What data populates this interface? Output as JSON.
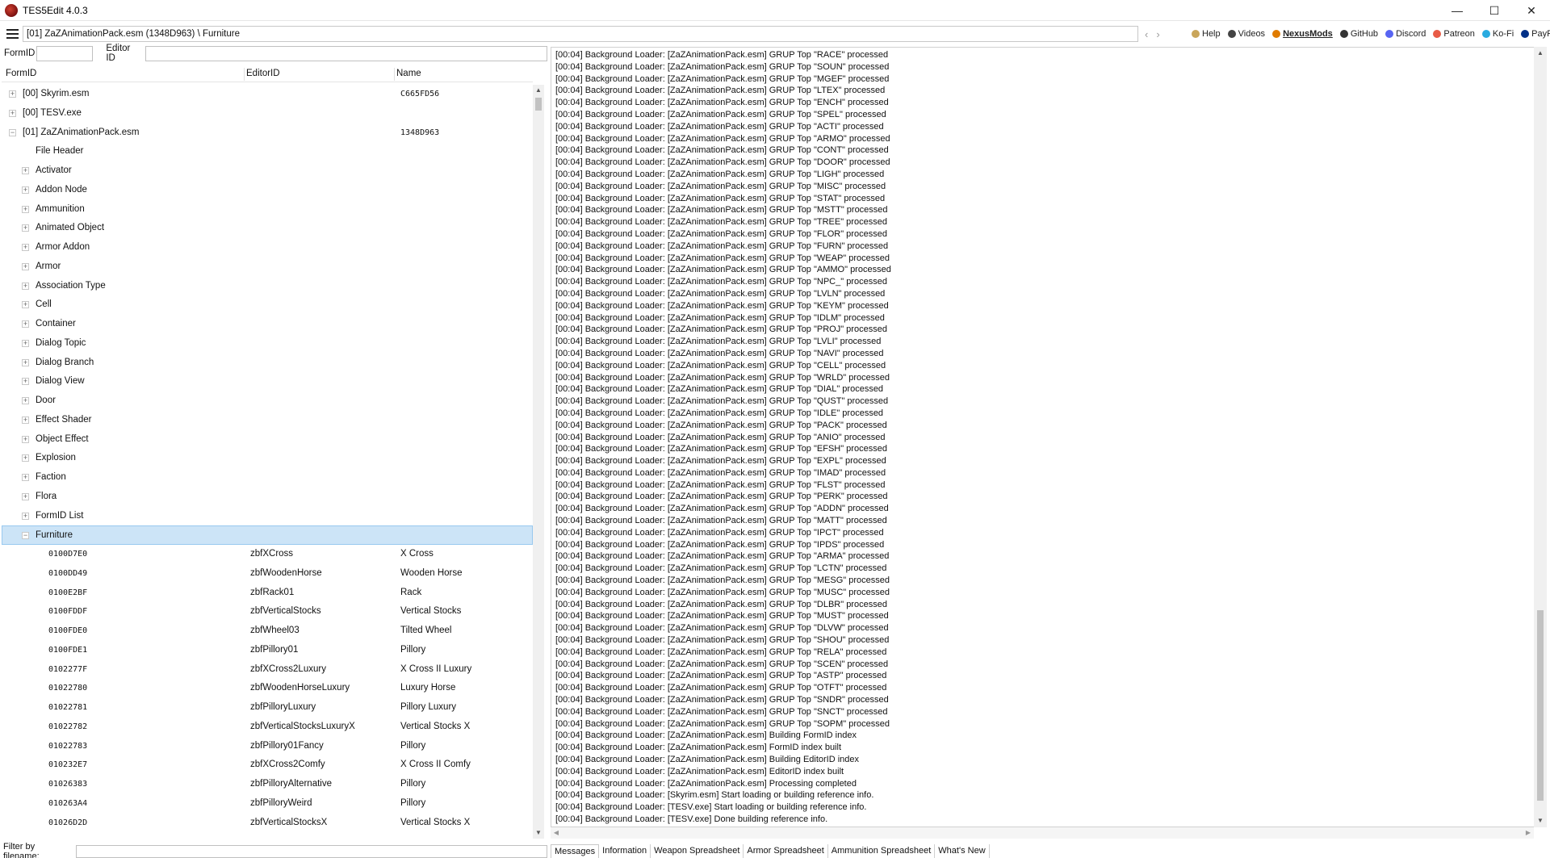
{
  "window": {
    "title": "TES5Edit 4.0.3",
    "minimize": "—",
    "maximize": "☐",
    "close": "✕"
  },
  "nav": {
    "path": "[01] ZaZAnimationPack.esm (1348D963) \\ Furniture",
    "back": "‹",
    "forward": "›",
    "links": [
      {
        "label": "Help",
        "icon": "book-icon",
        "color": "#c9a55a"
      },
      {
        "label": "Videos",
        "icon": "video-icon",
        "color": "#444444"
      },
      {
        "label": "NexusMods",
        "icon": "nexus-icon",
        "color": "#e07b00"
      },
      {
        "label": "GitHub",
        "icon": "github-icon",
        "color": "#333333"
      },
      {
        "label": "Discord",
        "icon": "discord-icon",
        "color": "#5865f2"
      },
      {
        "label": "Patreon",
        "icon": "patreon-icon",
        "color": "#e85b46"
      },
      {
        "label": "Ko-Fi",
        "icon": "kofi-icon",
        "color": "#29abe0"
      },
      {
        "label": "PayPal",
        "icon": "paypal-icon",
        "color": "#003087"
      }
    ]
  },
  "filters": {
    "formid_label": "FormID",
    "editorid_label": "Editor ID",
    "filename_label": "Filter by filename:"
  },
  "tree_columns": [
    "FormID",
    "EditorID",
    "Name"
  ],
  "tree_files": [
    {
      "label": "[00] Skyrim.esm",
      "name": "C665FD56",
      "exp": "+"
    },
    {
      "label": "[00] TESV.exe",
      "name": "",
      "exp": "+"
    },
    {
      "label": "[01] ZaZAnimationPack.esm",
      "name": "1348D963",
      "exp": "−"
    }
  ],
  "tree_file_header": "File Header",
  "tree_groups": [
    "Activator",
    "Addon Node",
    "Ammunition",
    "Animated Object",
    "Armor Addon",
    "Armor",
    "Association Type",
    "Cell",
    "Container",
    "Dialog Topic",
    "Dialog Branch",
    "Dialog View",
    "Door",
    "Effect Shader",
    "Object Effect",
    "Explosion",
    "Faction",
    "Flora",
    "FormID List"
  ],
  "tree_selected": "Furniture",
  "records": [
    {
      "formid": "0100D7E0",
      "editorid": "zbfXCross",
      "name": "X Cross"
    },
    {
      "formid": "0100DD49",
      "editorid": "zbfWoodenHorse",
      "name": "Wooden Horse"
    },
    {
      "formid": "0100E2BF",
      "editorid": "zbfRack01",
      "name": "Rack"
    },
    {
      "formid": "0100FDDF",
      "editorid": "zbfVerticalStocks",
      "name": "Vertical Stocks"
    },
    {
      "formid": "0100FDE0",
      "editorid": "zbfWheel03",
      "name": "Tilted Wheel"
    },
    {
      "formid": "0100FDE1",
      "editorid": "zbfPillory01",
      "name": "Pillory"
    },
    {
      "formid": "0102277F",
      "editorid": "zbfXCross2Luxury",
      "name": "X Cross II Luxury"
    },
    {
      "formid": "01022780",
      "editorid": "zbfWoodenHorseLuxury",
      "name": "Luxury Horse"
    },
    {
      "formid": "01022781",
      "editorid": "zbfPilloryLuxury",
      "name": "Pillory Luxury"
    },
    {
      "formid": "01022782",
      "editorid": "zbfVerticalStocksLuxuryX",
      "name": "Vertical Stocks X"
    },
    {
      "formid": "01022783",
      "editorid": "zbfPillory01Fancy",
      "name": "Pillory"
    },
    {
      "formid": "010232E7",
      "editorid": "zbfXCross2Comfy",
      "name": "X Cross II Comfy"
    },
    {
      "formid": "01026383",
      "editorid": "zbfPilloryAlternative",
      "name": "Pillory"
    },
    {
      "formid": "010263A4",
      "editorid": "zbfPilloryWeird",
      "name": "Pillory"
    },
    {
      "formid": "01026D2D",
      "editorid": "zbfVerticalStocksX",
      "name": "Vertical Stocks X"
    }
  ],
  "messages": [
    "[00:04] Background Loader: [ZaZAnimationPack.esm] GRUP Top \"RACE\" processed",
    "[00:04] Background Loader: [ZaZAnimationPack.esm] GRUP Top \"SOUN\" processed",
    "[00:04] Background Loader: [ZaZAnimationPack.esm] GRUP Top \"MGEF\" processed",
    "[00:04] Background Loader: [ZaZAnimationPack.esm] GRUP Top \"LTEX\" processed",
    "[00:04] Background Loader: [ZaZAnimationPack.esm] GRUP Top \"ENCH\" processed",
    "[00:04] Background Loader: [ZaZAnimationPack.esm] GRUP Top \"SPEL\" processed",
    "[00:04] Background Loader: [ZaZAnimationPack.esm] GRUP Top \"ACTI\" processed",
    "[00:04] Background Loader: [ZaZAnimationPack.esm] GRUP Top \"ARMO\" processed",
    "[00:04] Background Loader: [ZaZAnimationPack.esm] GRUP Top \"CONT\" processed",
    "[00:04] Background Loader: [ZaZAnimationPack.esm] GRUP Top \"DOOR\" processed",
    "[00:04] Background Loader: [ZaZAnimationPack.esm] GRUP Top \"LIGH\" processed",
    "[00:04] Background Loader: [ZaZAnimationPack.esm] GRUP Top \"MISC\" processed",
    "[00:04] Background Loader: [ZaZAnimationPack.esm] GRUP Top \"STAT\" processed",
    "[00:04] Background Loader: [ZaZAnimationPack.esm] GRUP Top \"MSTT\" processed",
    "[00:04] Background Loader: [ZaZAnimationPack.esm] GRUP Top \"TREE\" processed",
    "[00:04] Background Loader: [ZaZAnimationPack.esm] GRUP Top \"FLOR\" processed",
    "[00:04] Background Loader: [ZaZAnimationPack.esm] GRUP Top \"FURN\" processed",
    "[00:04] Background Loader: [ZaZAnimationPack.esm] GRUP Top \"WEAP\" processed",
    "[00:04] Background Loader: [ZaZAnimationPack.esm] GRUP Top \"AMMO\" processed",
    "[00:04] Background Loader: [ZaZAnimationPack.esm] GRUP Top \"NPC_\" processed",
    "[00:04] Background Loader: [ZaZAnimationPack.esm] GRUP Top \"LVLN\" processed",
    "[00:04] Background Loader: [ZaZAnimationPack.esm] GRUP Top \"KEYM\" processed",
    "[00:04] Background Loader: [ZaZAnimationPack.esm] GRUP Top \"IDLM\" processed",
    "[00:04] Background Loader: [ZaZAnimationPack.esm] GRUP Top \"PROJ\" processed",
    "[00:04] Background Loader: [ZaZAnimationPack.esm] GRUP Top \"LVLI\" processed",
    "[00:04] Background Loader: [ZaZAnimationPack.esm] GRUP Top \"NAVI\" processed",
    "[00:04] Background Loader: [ZaZAnimationPack.esm] GRUP Top \"CELL\" processed",
    "[00:04] Background Loader: [ZaZAnimationPack.esm] GRUP Top \"WRLD\" processed",
    "[00:04] Background Loader: [ZaZAnimationPack.esm] GRUP Top \"DIAL\" processed",
    "[00:04] Background Loader: [ZaZAnimationPack.esm] GRUP Top \"QUST\" processed",
    "[00:04] Background Loader: [ZaZAnimationPack.esm] GRUP Top \"IDLE\" processed",
    "[00:04] Background Loader: [ZaZAnimationPack.esm] GRUP Top \"PACK\" processed",
    "[00:04] Background Loader: [ZaZAnimationPack.esm] GRUP Top \"ANIO\" processed",
    "[00:04] Background Loader: [ZaZAnimationPack.esm] GRUP Top \"EFSH\" processed",
    "[00:04] Background Loader: [ZaZAnimationPack.esm] GRUP Top \"EXPL\" processed",
    "[00:04] Background Loader: [ZaZAnimationPack.esm] GRUP Top \"IMAD\" processed",
    "[00:04] Background Loader: [ZaZAnimationPack.esm] GRUP Top \"FLST\" processed",
    "[00:04] Background Loader: [ZaZAnimationPack.esm] GRUP Top \"PERK\" processed",
    "[00:04] Background Loader: [ZaZAnimationPack.esm] GRUP Top \"ADDN\" processed",
    "[00:04] Background Loader: [ZaZAnimationPack.esm] GRUP Top \"MATT\" processed",
    "[00:04] Background Loader: [ZaZAnimationPack.esm] GRUP Top \"IPCT\" processed",
    "[00:04] Background Loader: [ZaZAnimationPack.esm] GRUP Top \"IPDS\" processed",
    "[00:04] Background Loader: [ZaZAnimationPack.esm] GRUP Top \"ARMA\" processed",
    "[00:04] Background Loader: [ZaZAnimationPack.esm] GRUP Top \"LCTN\" processed",
    "[00:04] Background Loader: [ZaZAnimationPack.esm] GRUP Top \"MESG\" processed",
    "[00:04] Background Loader: [ZaZAnimationPack.esm] GRUP Top \"MUSC\" processed",
    "[00:04] Background Loader: [ZaZAnimationPack.esm] GRUP Top \"DLBR\" processed",
    "[00:04] Background Loader: [ZaZAnimationPack.esm] GRUP Top \"MUST\" processed",
    "[00:04] Background Loader: [ZaZAnimationPack.esm] GRUP Top \"DLVW\" processed",
    "[00:04] Background Loader: [ZaZAnimationPack.esm] GRUP Top \"SHOU\" processed",
    "[00:04] Background Loader: [ZaZAnimationPack.esm] GRUP Top \"RELA\" processed",
    "[00:04] Background Loader: [ZaZAnimationPack.esm] GRUP Top \"SCEN\" processed",
    "[00:04] Background Loader: [ZaZAnimationPack.esm] GRUP Top \"ASTP\" processed",
    "[00:04] Background Loader: [ZaZAnimationPack.esm] GRUP Top \"OTFT\" processed",
    "[00:04] Background Loader: [ZaZAnimationPack.esm] GRUP Top \"SNDR\" processed",
    "[00:04] Background Loader: [ZaZAnimationPack.esm] GRUP Top \"SNCT\" processed",
    "[00:04] Background Loader: [ZaZAnimationPack.esm] GRUP Top \"SOPM\" processed",
    "[00:04] Background Loader: [ZaZAnimationPack.esm] Building FormID index",
    "[00:04] Background Loader: [ZaZAnimationPack.esm] FormID index built",
    "[00:04] Background Loader: [ZaZAnimationPack.esm] Building EditorID index",
    "[00:04] Background Loader: [ZaZAnimationPack.esm] EditorID index built",
    "[00:04] Background Loader: [ZaZAnimationPack.esm] Processing completed",
    "[00:04] Background Loader: [Skyrim.esm] Start loading or building reference info.",
    "[00:04] Background Loader: [TESV.exe] Start loading or building reference info.",
    "[00:04] Background Loader: [TESV.exe] Done building reference info."
  ],
  "tabs": [
    "Messages",
    "Information",
    "Weapon Spreadsheet",
    "Armor Spreadsheet",
    "Ammunition Spreadsheet",
    "What's New"
  ],
  "active_tab": "Messages"
}
